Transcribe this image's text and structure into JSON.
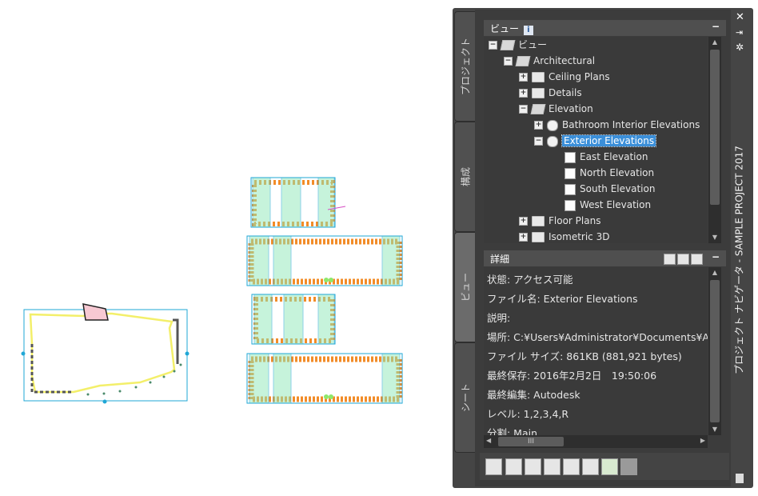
{
  "side_tabs": [
    {
      "label": "プロジェクト"
    },
    {
      "label": "構成"
    },
    {
      "label": "ビュー"
    },
    {
      "label": "シート"
    }
  ],
  "view_header": {
    "title": "ビュー",
    "info": "i",
    "collapse": "−"
  },
  "tree": [
    {
      "label": "ビュー",
      "expander": "−",
      "icon": "folder-open-icon"
    },
    {
      "label": "Architectural",
      "expander": "−",
      "icon": "folder-open-icon"
    },
    {
      "label": "Ceiling Plans",
      "expander": "+",
      "icon": "folder-icon"
    },
    {
      "label": "Details",
      "expander": "+",
      "icon": "folder-icon"
    },
    {
      "label": "Elevation",
      "expander": "−",
      "icon": "folder-open-icon"
    },
    {
      "label": "Bathroom Interior Elevations",
      "expander": "+",
      "icon": "elevation-icon"
    },
    {
      "label": "Exterior Elevations",
      "expander": "−",
      "icon": "elevation-icon"
    },
    {
      "label": "East Elevation",
      "icon": "view-icon"
    },
    {
      "label": "North Elevation",
      "icon": "view-icon"
    },
    {
      "label": "South Elevation",
      "icon": "view-icon"
    },
    {
      "label": "West Elevation",
      "icon": "view-icon"
    },
    {
      "label": "Floor Plans",
      "expander": "+",
      "icon": "folder-icon"
    },
    {
      "label": "Isometric 3D",
      "expander": "+",
      "icon": "folder-icon"
    }
  ],
  "details_header": {
    "title": "詳細",
    "collapse": "−"
  },
  "details": [
    "状態: アクセス可能",
    "ファイル名: Exterior Elevations",
    "説明:",
    "場所: C:¥Users¥Administrator¥Documents¥Autodesk",
    "ファイル サイズ: 861KB (881,921 bytes)",
    "最終保存: 2016年2月2日　19:50:06",
    "最終編集: Autodesk",
    "レベル: 1,2,3,4,R",
    "分割: Main"
  ],
  "hscroll_label": "III",
  "palette_title": "プロジェクト ナビゲータ - SAMPLE PROJECT 2017",
  "colors": {
    "palette_bg": "#3c3c3c",
    "selection": "#3b8fd9",
    "drawing_orange": "#f28c28",
    "drawing_cyan": "#1fa7d6",
    "drawing_green": "#8ee8b8"
  }
}
